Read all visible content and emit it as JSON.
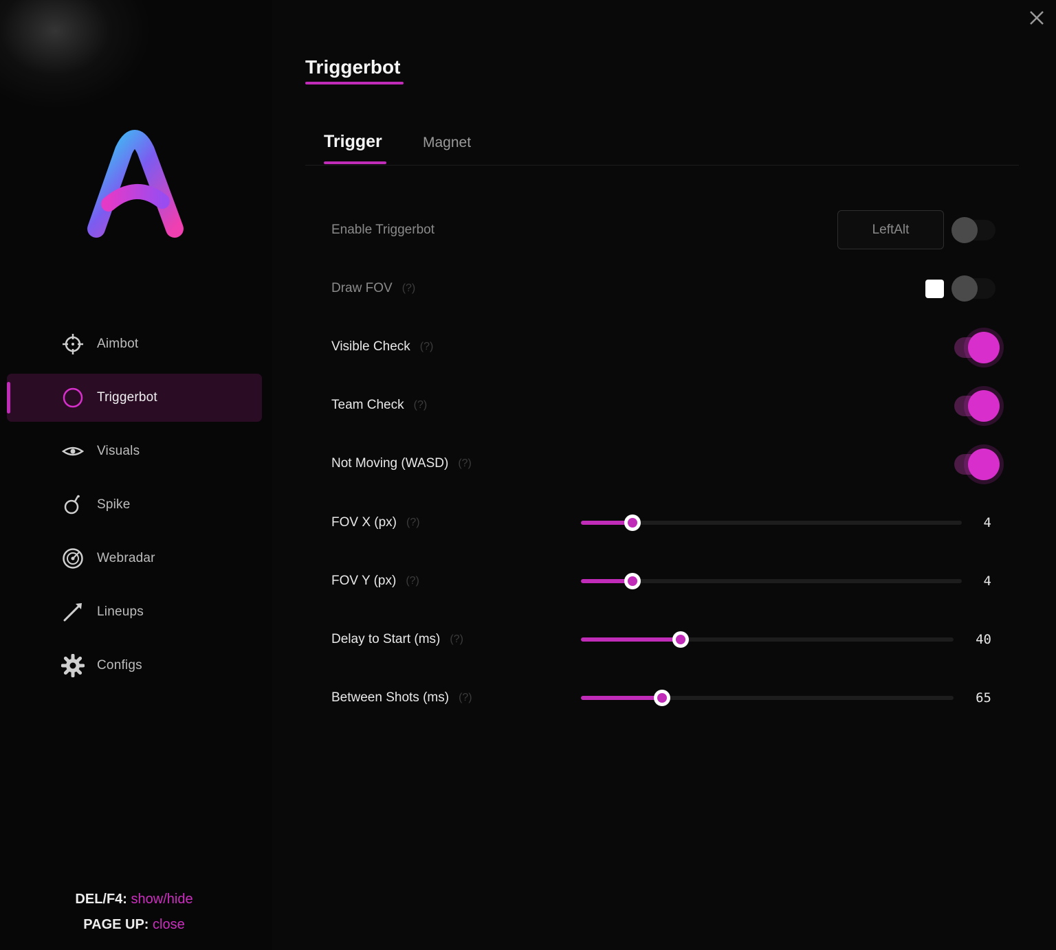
{
  "sidebar": {
    "logo_letter": "A",
    "items": [
      {
        "label": "Aimbot",
        "icon": "crosshair-icon",
        "active": false
      },
      {
        "label": "Triggerbot",
        "icon": "circle-icon",
        "active": true
      },
      {
        "label": "Visuals",
        "icon": "eye-icon",
        "active": false
      },
      {
        "label": "Spike",
        "icon": "bomb-icon",
        "active": false
      },
      {
        "label": "Webradar",
        "icon": "radar-icon",
        "active": false
      },
      {
        "label": "Lineups",
        "icon": "line-arrow-icon",
        "active": false
      },
      {
        "label": "Configs",
        "icon": "gear-icon",
        "active": false
      }
    ],
    "hints": [
      {
        "key": "DEL/F4:",
        "action": "show/hide"
      },
      {
        "key": "PAGE UP:",
        "action": "close"
      }
    ]
  },
  "header": {
    "title": "Triggerbot"
  },
  "tabs": [
    {
      "label": "Trigger",
      "active": true
    },
    {
      "label": "Magnet",
      "active": false
    }
  ],
  "settings": {
    "enable_triggerbot": {
      "label": "Enable Triggerbot",
      "keybind": "LeftAlt",
      "enabled": false
    },
    "draw_fov": {
      "label": "Draw FOV",
      "help": "(?)",
      "color": "#ffffff",
      "enabled": false
    },
    "visible_check": {
      "label": "Visible Check",
      "help": "(?)",
      "enabled": true
    },
    "team_check": {
      "label": "Team Check",
      "help": "(?)",
      "enabled": true
    },
    "not_moving": {
      "label": "Not Moving (WASD)",
      "help": "(?)",
      "enabled": true
    }
  },
  "sliders": [
    {
      "label": "FOV X (px)",
      "help": "(?)",
      "value": "4",
      "fraction": 0.135
    },
    {
      "label": "FOV Y (px)",
      "help": "(?)",
      "value": "4",
      "fraction": 0.135
    },
    {
      "label": "Delay to Start (ms)",
      "help": "(?)",
      "value": "40",
      "fraction": 0.267
    },
    {
      "label": "Between Shots (ms)",
      "help": "(?)",
      "value": "65",
      "fraction": 0.217
    }
  ],
  "colors": {
    "accent": "#c02bb8",
    "background": "#090909",
    "sidebar": "#070707"
  }
}
